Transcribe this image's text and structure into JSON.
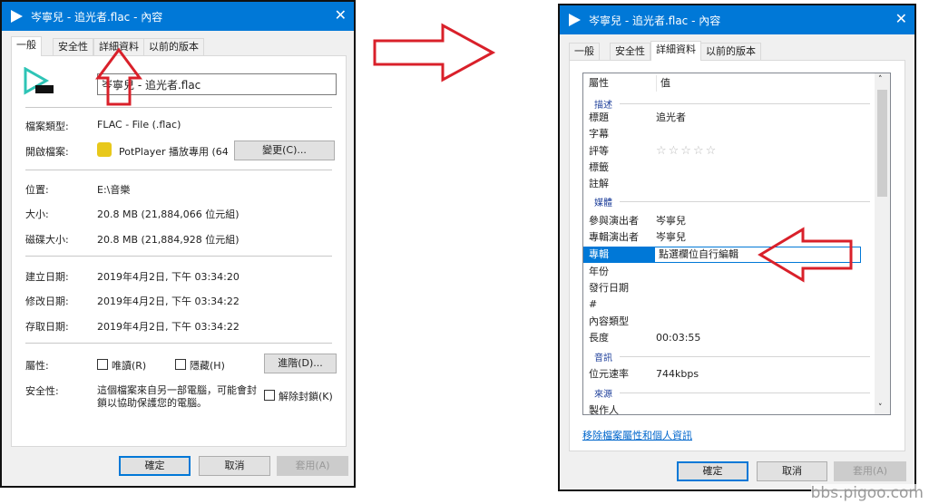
{
  "left_dialog": {
    "title": "岑寧兒 - 追光者.flac - 內容",
    "tabs": [
      "一般",
      "安全性",
      "詳細資料",
      "以前的版本"
    ],
    "active_tab": "一般",
    "file_name": "岑寧兒 - 追光者.flac",
    "file_icon_label": "FLAC",
    "fields": {
      "type_label": "檔案類型:",
      "type_value": "FLAC - File (.flac)",
      "open_label": "開啟檔案:",
      "open_value": "PotPlayer 播放專用 (64",
      "change_button": "變更(C)...",
      "location_label": "位置:",
      "location_value": "E:\\音樂",
      "size_label": "大小:",
      "size_value": "20.8 MB (21,884,066 位元組)",
      "disk_label": "磁碟大小:",
      "disk_value": "20.8 MB (21,884,928 位元組)",
      "created_label": "建立日期:",
      "created_value": "2019年4月2日, 下午 03:34:20",
      "modified_label": "修改日期:",
      "modified_value": "2019年4月2日, 下午 03:34:22",
      "accessed_label": "存取日期:",
      "accessed_value": "2019年4月2日, 下午 03:34:22",
      "attr_label": "屬性:",
      "readonly": "唯讀(R)",
      "hidden": "隱藏(H)",
      "advanced_button": "進階(D)...",
      "security_label": "安全性:",
      "security_text_1": "這個檔案來自另一部電腦，可能會封",
      "security_text_2": "鎖以協助保護您的電腦。",
      "unblock": "解除封鎖(K)"
    },
    "buttons": {
      "ok": "確定",
      "cancel": "取消",
      "apply": "套用(A)"
    }
  },
  "right_dialog": {
    "title": "岑寧兒 - 追光者.flac - 內容",
    "tabs": [
      "一般",
      "安全性",
      "詳細資料",
      "以前的版本"
    ],
    "active_tab": "詳細資料",
    "header": {
      "property": "屬性",
      "value": "值"
    },
    "groups": {
      "description": "描述",
      "media": "媒體",
      "audio": "音訊",
      "origin": "來源"
    },
    "rows": {
      "title": {
        "k": "標題",
        "v": "追光者"
      },
      "subtitle": {
        "k": "字幕",
        "v": ""
      },
      "rating": {
        "k": "評等",
        "v": "☆☆☆☆☆"
      },
      "tags": {
        "k": "標籤",
        "v": ""
      },
      "comments": {
        "k": "註解",
        "v": ""
      },
      "artist": {
        "k": "參與演出者",
        "v": "岑寧兒"
      },
      "album_artist": {
        "k": "專輯演出者",
        "v": "岑寧兒"
      },
      "album": {
        "k": "專輯",
        "v": "點選欄位自行編輯"
      },
      "year": {
        "k": "年份",
        "v": ""
      },
      "release": {
        "k": "發行日期",
        "v": ""
      },
      "track": {
        "k": "#",
        "v": ""
      },
      "genre": {
        "k": "內容類型",
        "v": ""
      },
      "length": {
        "k": "長度",
        "v": "00:03:55"
      },
      "bitrate": {
        "k": "位元速率",
        "v": "744kbps"
      },
      "producer": {
        "k": "製作人",
        "v": ""
      }
    },
    "rating_stars": 0,
    "remove_link": "移除檔案屬性和個人資訊",
    "buttons": {
      "ok": "確定",
      "cancel": "取消",
      "apply": "套用(A)"
    }
  },
  "watermark": "bbs.pigoo.com",
  "colors": {
    "titlebar": "#0078d7",
    "arrow": "#d9202a",
    "selection": "#0078d7"
  }
}
